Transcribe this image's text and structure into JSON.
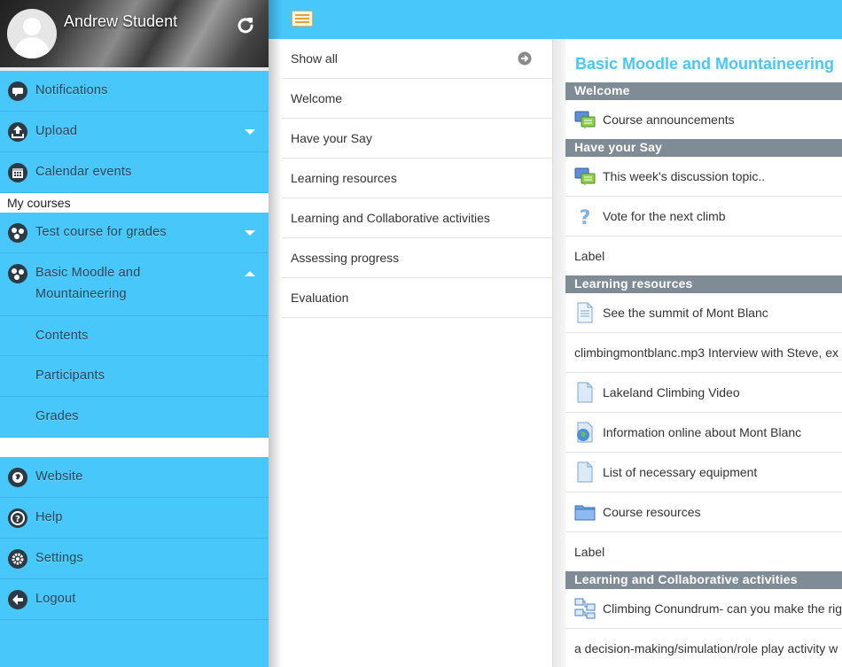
{
  "user": {
    "name": "Andrew Student"
  },
  "menu": {
    "items": [
      {
        "label": "Notifications",
        "icon": "notifications-icon"
      },
      {
        "label": "Upload",
        "icon": "upload-icon"
      },
      {
        "label": "Calendar events",
        "icon": "calendar-icon"
      }
    ],
    "my_courses_header": "My courses",
    "courses": [
      {
        "label": "Test course for grades",
        "expanded": false
      },
      {
        "label_line1": "Basic Moodle and",
        "label_line2": "Mountaineering",
        "expanded": true
      }
    ],
    "course_subitems": [
      "Contents",
      "Participants",
      "Grades"
    ],
    "bottom_items": [
      {
        "label": "Website",
        "icon": "globe-icon"
      },
      {
        "label": "Help",
        "icon": "help-icon"
      },
      {
        "label": "Settings",
        "icon": "gear-icon"
      },
      {
        "label": "Logout",
        "icon": "logout-icon"
      }
    ]
  },
  "sections": [
    "Show all",
    "Welcome",
    "Have your Say",
    "Learning resources",
    "Learning and Collaborative activities",
    "Assessing progress",
    "Evaluation"
  ],
  "course": {
    "title": "Basic Moodle and Mountaineering",
    "section_headers": [
      "Welcome",
      "Have your Say",
      "Learning resources",
      "Learning and Collaborative activities"
    ],
    "activities": [
      {
        "label": "Course announcements",
        "icon": "forum-icon"
      },
      {
        "label": "This week's discussion topic..",
        "icon": "forum-icon"
      },
      {
        "label": "Vote for the next climb",
        "icon": "question-icon"
      },
      {
        "label": "Label",
        "icon": ""
      },
      {
        "label": "See the summit of Mont Blanc",
        "icon": "page-icon"
      },
      {
        "label": "climbingmontblanc.mp3 Interview with Steve, ex",
        "icon": ""
      },
      {
        "label": "Lakeland Climbing Video",
        "icon": "file-icon"
      },
      {
        "label": "Information online about Mont Blanc",
        "icon": "url-icon"
      },
      {
        "label": "List of necessary equipment",
        "icon": "file-icon"
      },
      {
        "label": "Course resources",
        "icon": "folder-icon"
      },
      {
        "label": "Label",
        "icon": ""
      },
      {
        "label": "Climbing Conundrum- can you make the rig",
        "icon": "lesson-icon"
      },
      {
        "label": "a decision-making/simulation/role play activity w",
        "icon": ""
      }
    ]
  },
  "colors": {
    "accent": "#48c7fa",
    "menu_text": "#29445a",
    "section_header": "#7f8c95"
  }
}
